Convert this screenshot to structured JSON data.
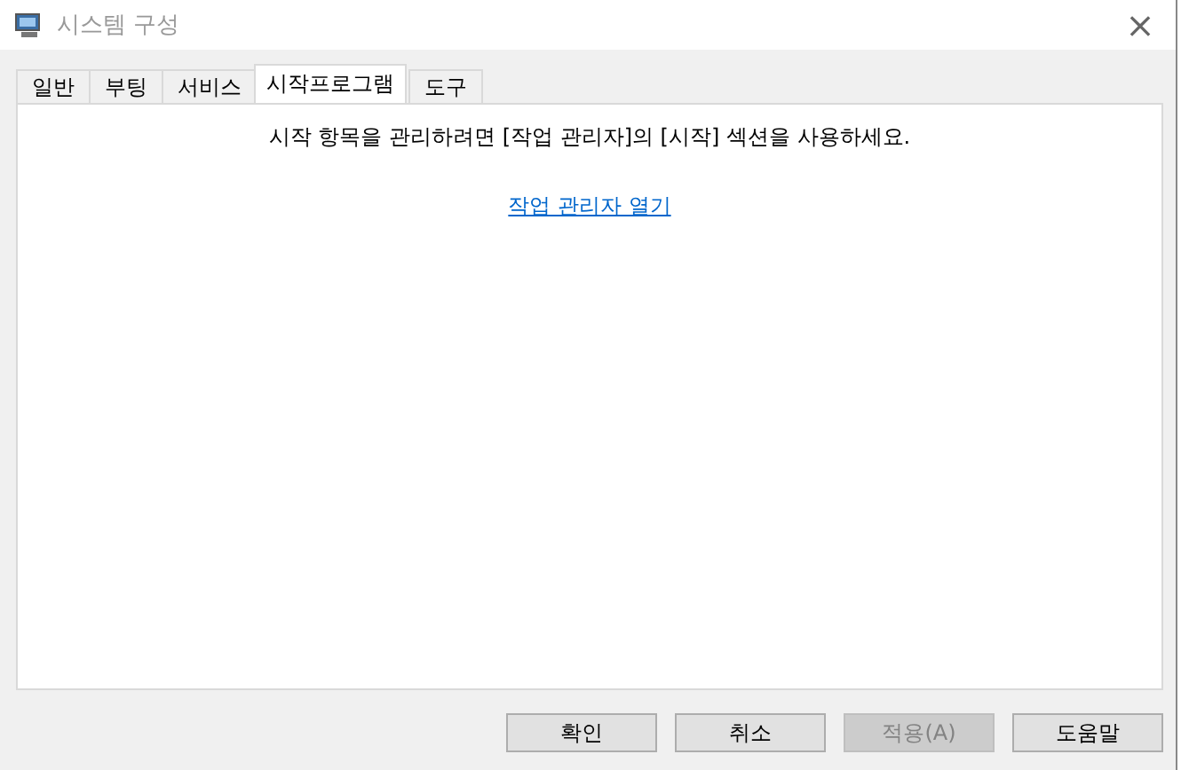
{
  "window": {
    "title": "시스템 구성",
    "close": "×"
  },
  "tabs": [
    {
      "label": "일반",
      "selected": false
    },
    {
      "label": "부팅",
      "selected": false
    },
    {
      "label": "서비스",
      "selected": false
    },
    {
      "label": "시작프로그램",
      "selected": true
    },
    {
      "label": "도구",
      "selected": false
    }
  ],
  "panel": {
    "message": "시작 항목을 관리하려면 [작업 관리자]의 [시작] 섹션을 사용하세요.",
    "link": "작업 관리자 열기"
  },
  "buttons": [
    {
      "label": "확인",
      "disabled": false
    },
    {
      "label": "취소",
      "disabled": false
    },
    {
      "label": "적용(A)",
      "disabled": true
    },
    {
      "label": "도움말",
      "disabled": false
    }
  ]
}
